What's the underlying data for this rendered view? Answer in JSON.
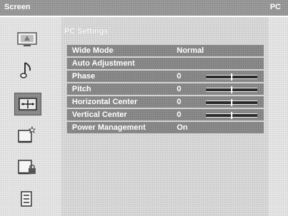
{
  "header": {
    "left": "Screen",
    "right": "PC"
  },
  "sidebar": {
    "icons": [
      {
        "name": "picture-icon"
      },
      {
        "name": "sound-note-icon"
      },
      {
        "name": "screen-adjust-icon",
        "selected": true
      },
      {
        "name": "features-icon"
      },
      {
        "name": "lock-icon"
      },
      {
        "name": "setup-list-icon"
      }
    ]
  },
  "main": {
    "section_title": "PC Settings",
    "rows": [
      {
        "label": "Wide Mode",
        "value": "Normal"
      },
      {
        "label": "Auto Adjustment",
        "value": ""
      },
      {
        "label": "Phase",
        "value": "0",
        "slider": 0.5
      },
      {
        "label": "Pitch",
        "value": "0",
        "slider": 0.5
      },
      {
        "label": "Horizontal Center",
        "value": "0",
        "slider": 0.5
      },
      {
        "label": "Vertical Center",
        "value": "0",
        "slider": 0.5
      },
      {
        "label": "Power Management",
        "value": "On"
      }
    ]
  },
  "colors": {
    "header": "#9a9a9a",
    "row": "#8a8a8a",
    "text": "#ffffff"
  }
}
